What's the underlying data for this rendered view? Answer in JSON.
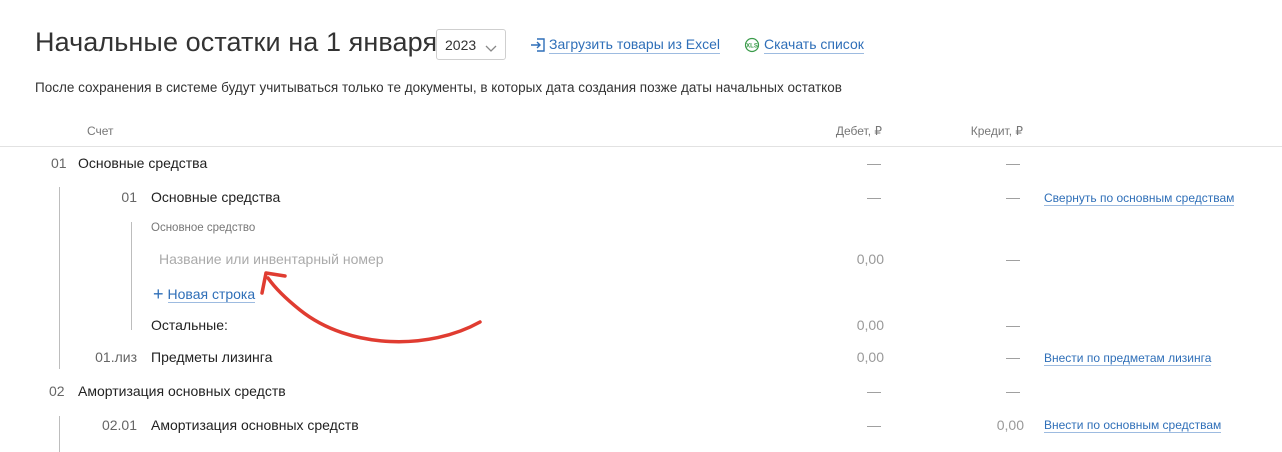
{
  "header": {
    "title": "Начальные остатки на 1 января",
    "year": "2023",
    "upload_link": "Загрузить товары из Excel",
    "download_link": "Скачать список",
    "download_icon_text": "XLS"
  },
  "notice": "После сохранения в системе будут учитываться только те документы, в которых дата создания позже даты начальных остатков",
  "columns": {
    "account": "Счет",
    "debit": "Дебет, ₽",
    "credit": "Кредит, ₽"
  },
  "rows": [
    {
      "code": "01",
      "name": "Основные средства",
      "debit": "—",
      "credit": "—"
    },
    {
      "code": "01",
      "name": "Основные средства",
      "debit": "—",
      "credit": "—",
      "action": "Свернуть по основным средствам"
    },
    {
      "sublabel": "Основное средство",
      "placeholder": "Название или инвентарный номер",
      "debit": "0,00",
      "credit": "—",
      "new_row": "Новая строка"
    },
    {
      "name": "Остальные:",
      "debit": "0,00",
      "credit": "—"
    },
    {
      "code": "01.лиз",
      "name": "Предметы лизинга",
      "debit": "0,00",
      "credit": "—",
      "action": "Внести по предметам лизинга"
    },
    {
      "code": "02",
      "name": "Амортизация основных средств",
      "debit": "—",
      "credit": "—"
    },
    {
      "code": "02.01",
      "name": "Амортизация основных средств",
      "debit": "—",
      "credit": "0,00",
      "action": "Внести по основным средствам"
    }
  ],
  "colors": {
    "link": "#2f6fb8",
    "annotation_arrow": "#e03c31",
    "text": "#222222",
    "muted": "#999999"
  }
}
